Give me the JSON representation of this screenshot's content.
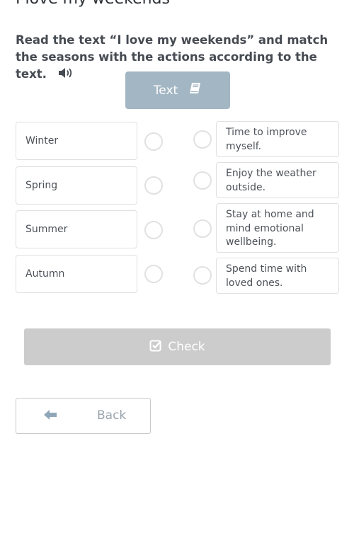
{
  "page": {
    "title": "I love my weekends",
    "instruction": "Read the text “I love my weekends” and match the seasons with the actions according to the text.",
    "audio_icon": "speaker-icon"
  },
  "text_button": {
    "label": "Text",
    "icon": "book-icon",
    "color": "#a3b6c3"
  },
  "matching": {
    "left": [
      {
        "label": "Winter"
      },
      {
        "label": "Spring"
      },
      {
        "label": "Summer"
      },
      {
        "label": "Autumn"
      }
    ],
    "right": [
      {
        "label": "Time to improve myself."
      },
      {
        "label": "Enjoy the weather outside."
      },
      {
        "label": "Stay at home and mind emotional wellbeing."
      },
      {
        "label": "Spend time with loved ones."
      }
    ]
  },
  "check_button": {
    "label": "Check",
    "icon": "checkbox-checked-icon",
    "color": "#cccccc"
  },
  "back_button": {
    "label": "Back",
    "icon": "arrow-left-icon"
  }
}
